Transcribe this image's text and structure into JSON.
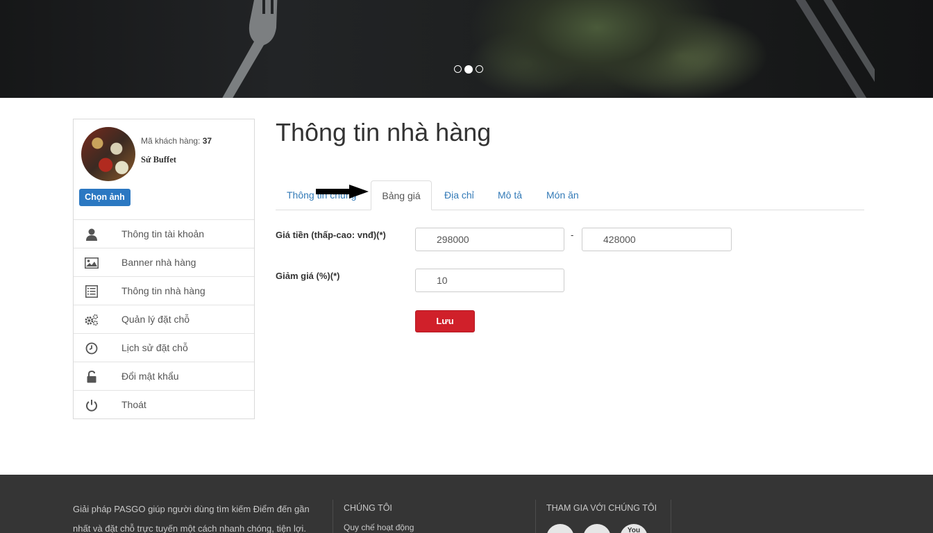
{
  "hero": {
    "slides": [
      {
        "active": false
      },
      {
        "active": true
      },
      {
        "active": false
      }
    ]
  },
  "sidebar": {
    "customer_label": "Mã khách hàng:",
    "customer_id": "37",
    "restaurant_name": "Sứ Buffet",
    "choose_image": "Chọn ảnh",
    "items": [
      {
        "label": "Thông tin tài khoản",
        "icon": "user-icon"
      },
      {
        "label": "Banner nhà hàng",
        "icon": "image-icon"
      },
      {
        "label": "Thông tin nhà hàng",
        "icon": "list-icon"
      },
      {
        "label": "Quản lý đặt chỗ",
        "icon": "gears-icon"
      },
      {
        "label": "Lịch sử đặt chỗ",
        "icon": "clock-icon"
      },
      {
        "label": "Đổi mật khẩu",
        "icon": "unlock-icon"
      },
      {
        "label": "Thoát",
        "icon": "power-icon"
      }
    ]
  },
  "main": {
    "title": "Thông tin nhà hàng",
    "tabs": [
      {
        "label": "Thông tin chung",
        "active": false
      },
      {
        "label": "Bảng giá",
        "active": true
      },
      {
        "label": "Địa chỉ",
        "active": false
      },
      {
        "label": "Mô tả",
        "active": false
      },
      {
        "label": "Món ăn",
        "active": false
      }
    ],
    "form": {
      "price_label": "Giá tiền (thấp-cao: vnđ)(*)",
      "price_min": "298000",
      "price_separator": "-",
      "price_max": "428000",
      "discount_label": "Giảm giá (%)(*)",
      "discount": "10",
      "save": "Lưu"
    }
  },
  "footer": {
    "about": "Giải pháp PASGO giúp người dùng tìm kiếm Điểm đến gần nhất và đặt chỗ trực tuyến một cách nhanh chóng, tiện lợi.",
    "col1_title": "CHÚNG TÔI",
    "col1_link": "Quy chế hoạt động",
    "col2_title": "THAM GIA VỚI CHÚNG TÔI",
    "social_youtube_text": "You"
  },
  "colors": {
    "link": "#337ab7",
    "primary_button": "#2b78c2",
    "save_button": "#d0202a",
    "footer_bg": "#353535"
  }
}
